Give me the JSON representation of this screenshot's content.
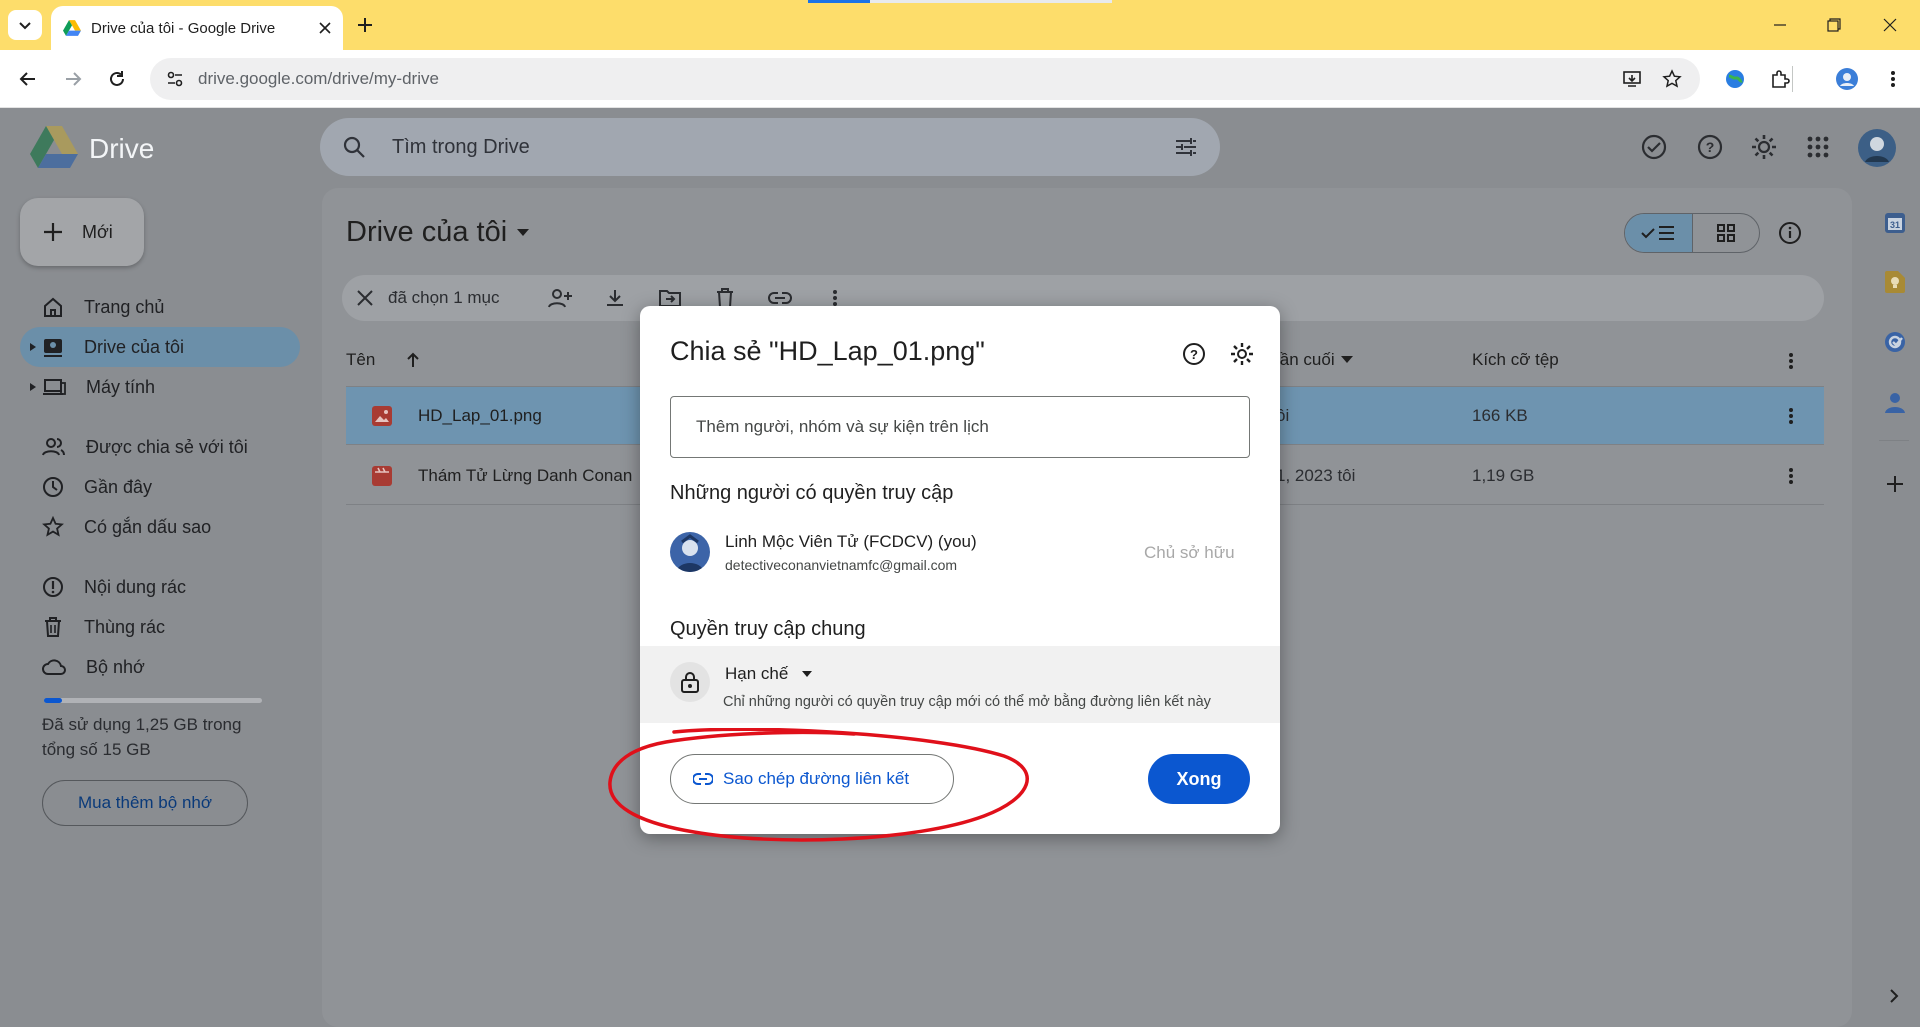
{
  "browser": {
    "tab_title": "Drive của tôi - Google Drive",
    "url": "drive.google.com/drive/my-drive",
    "titlebar_color": "#fddd6b"
  },
  "drive": {
    "logo_text": "Drive",
    "search_placeholder": "Tìm trong Drive",
    "new_button": "Mới",
    "sidebar": {
      "items": [
        {
          "label": "Trang chủ",
          "icon": "home-icon"
        },
        {
          "label": "Drive của tôi",
          "icon": "my-drive-icon",
          "active": true
        },
        {
          "label": "Máy tính",
          "icon": "computer-icon"
        },
        {
          "label": "Được chia sẻ với tôi",
          "icon": "shared-icon"
        },
        {
          "label": "Gần đây",
          "icon": "clock-icon"
        },
        {
          "label": "Có gắn dấu sao",
          "icon": "star-icon"
        },
        {
          "label": "Nội dung rác",
          "icon": "spam-icon"
        },
        {
          "label": "Thùng rác",
          "icon": "trash-icon"
        },
        {
          "label": "Bộ nhớ",
          "icon": "cloud-icon"
        }
      ],
      "storage_text": "Đã sử dụng 1,25 GB trong tổng số 15 GB",
      "storage_fraction": 0.083,
      "buy_storage": "Mua thêm bộ nhớ"
    },
    "main": {
      "title": "Drive của tôi",
      "selection_label": "đã chọn 1 mục",
      "columns": {
        "name": "Tên",
        "modified": "lần cuối",
        "size": "Kích cỡ tệp"
      },
      "files": [
        {
          "name": "HD_Lap_01.png",
          "modified": "ôi",
          "size": "166 KB",
          "selected": true,
          "type": "image"
        },
        {
          "name": "Thám Tử Lừng Danh Conan",
          "modified": "1, 2023 tôi",
          "size": "1,19 GB",
          "selected": false,
          "type": "video"
        }
      ]
    }
  },
  "dialog": {
    "title": "Chia sẻ \"HD_Lap_01.png\"",
    "input_placeholder": "Thêm người, nhóm và sự kiện trên lịch",
    "access_heading": "Những người có quyền truy cập",
    "person": {
      "name": "Linh Mộc Viên Tử (FCDCV) (you)",
      "email": "detectiveconanvietnamfc@gmail.com",
      "role": "Chủ sở hữu"
    },
    "general_heading": "Quyền truy cập chung",
    "restriction": "Hạn chế",
    "restriction_desc": "Chỉ những người có quyền truy cập mới có thể mở bằng đường liên kết này",
    "copy_link": "Sao chép đường liên kết",
    "done": "Xong",
    "accent_color": "#0b57d0",
    "annotation_color": "#e0101a"
  }
}
